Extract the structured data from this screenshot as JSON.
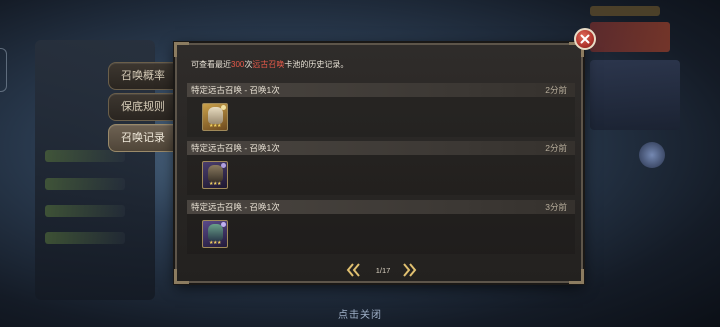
{
  "tabs": [
    {
      "label": "召唤概率",
      "active": false
    },
    {
      "label": "保底规则",
      "active": false
    },
    {
      "label": "召唤记录",
      "active": true
    }
  ],
  "info": {
    "prefix": "可查看最近",
    "count": "300",
    "count_suffix": "次",
    "pool": "远古召唤",
    "suffix": "卡池的历史记录。"
  },
  "records": [
    {
      "title": "特定远古召唤 - 召唤1次",
      "time": "2分前",
      "hero_icon": "hero-card-gold",
      "stars": "★★★"
    },
    {
      "title": "特定远古召唤 - 召唤1次",
      "time": "2分前",
      "hero_icon": "hero-card-purple",
      "stars": "★★★"
    },
    {
      "title": "特定远古召唤 - 召唤1次",
      "time": "3分前",
      "hero_icon": "hero-card-purple",
      "stars": "★★★"
    }
  ],
  "pager": {
    "page": "1/17"
  },
  "dismiss_label": "点击关闭",
  "colors": {
    "highlight": "#e85a4a",
    "star": "#f0d060",
    "close": "#b0352c"
  }
}
